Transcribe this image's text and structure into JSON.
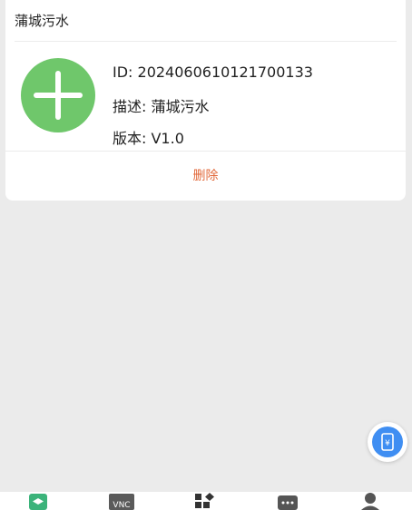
{
  "card": {
    "title": "蒲城污水",
    "id_line": "ID: 2024060610121700133",
    "desc_line": "描述: 蒲城污水",
    "version_line": "版本: V1.0",
    "delete_label": "删除"
  },
  "float_button": {
    "icon": "phone-yuan-icon",
    "glyph": "¥"
  },
  "tabbar": {
    "vnc_label": "VNC",
    "tabs": [
      {
        "icon": "layers-icon",
        "color": "#3bb37a"
      },
      {
        "icon": "vnc-icon"
      },
      {
        "icon": "apps-icon"
      },
      {
        "icon": "chat-icon"
      },
      {
        "icon": "user-icon"
      }
    ]
  },
  "colors": {
    "accent_green": "#6fc76b",
    "delete_red": "#e2693b",
    "float_blue": "#3f8ef2",
    "background": "#ebebeb"
  }
}
